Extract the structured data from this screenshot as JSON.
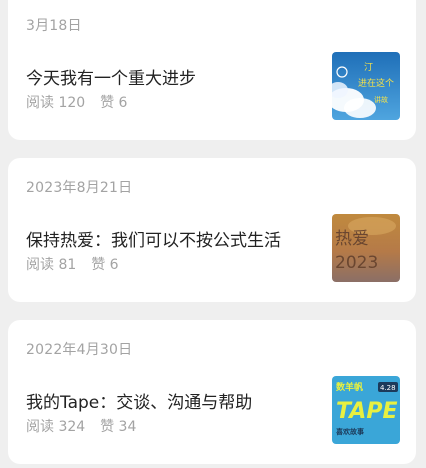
{
  "posts": [
    {
      "date": "3月18日",
      "title": "今天我有一个重大进步",
      "reads_label": "阅读",
      "reads": "120",
      "likes_label": "赞",
      "likes": "6",
      "thumbnail": {
        "texts": [
          "汀",
          "进在这个",
          "讲故"
        ],
        "colors": {
          "sky": "#2f86c9",
          "cloud": "#ffffff",
          "text": "#f5e24a"
        }
      }
    },
    {
      "date": "2023年8月21日",
      "title": "保持热爱：我们可以不按公式生活",
      "reads_label": "阅读",
      "reads": "81",
      "likes_label": "赞",
      "likes": "6",
      "thumbnail": {
        "texts": [
          "热爱",
          "2023"
        ],
        "colors": {
          "top": "#b07a3a",
          "bottom": "#8a6a5a",
          "text": "#5a3a2a"
        }
      }
    },
    {
      "date": "2022年4月30日",
      "title": "我的Tape：交谈、沟通与帮助",
      "reads_label": "阅读",
      "reads": "324",
      "likes_label": "赞",
      "likes": "34",
      "thumbnail": {
        "texts": [
          "数羊帆",
          "4.28",
          "TAPE",
          "喜欢故事"
        ],
        "colors": {
          "bg": "#3aa6d8",
          "accent": "#e8f040",
          "dark": "#1c3a5a"
        }
      }
    }
  ]
}
